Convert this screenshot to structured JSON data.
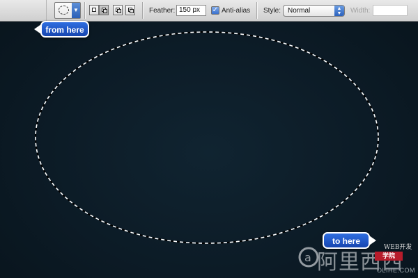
{
  "toolbar": {
    "feather_label": "Feather:",
    "feather_value": "150 px",
    "antialias_label": "Anti-alias",
    "antialias_checked": true,
    "style_label": "Style:",
    "style_value": "Normal",
    "width_label": "Width:",
    "width_value": "",
    "tool_icon": "elliptical-marquee-icon",
    "mode_icons": [
      "new-selection-icon",
      "add-to-selection-icon",
      "subtract-from-selection-icon",
      "intersect-selection-icon"
    ]
  },
  "callouts": {
    "from_label": "from here",
    "to_label": "to here"
  },
  "watermark": {
    "top_text": "WEB开发",
    "badge_text": "学院",
    "main_text": "阿里西西",
    "sub_text": "OLIHE.COM"
  },
  "colors": {
    "canvas_bg": "#0b1a24",
    "callout_blue": "#1f56c8",
    "selection_stroke": "#ffffff"
  }
}
